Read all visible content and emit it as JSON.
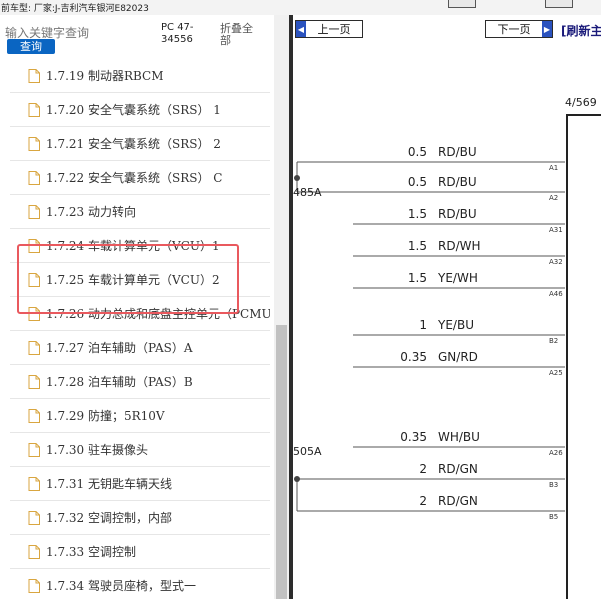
{
  "window": {
    "caption": "前车型: 厂家:J-吉利汽车银河E82023"
  },
  "sidebar": {
    "search_placeholder": "输入关键字查询",
    "search_button": "查询",
    "pc_label": "PC 47-34556",
    "collapse_all": "折叠全部",
    "items": [
      {
        "label": "1.7.19 制动器RBCM"
      },
      {
        "label": "1.7.20 安全气囊系统（SRS） 1"
      },
      {
        "label": "1.7.21 安全气囊系统（SRS） 2"
      },
      {
        "label": "1.7.22 安全气囊系统（SRS） C"
      },
      {
        "label": "1.7.23 动力转向"
      },
      {
        "label": "1.7.24 车载计算单元（VCU）1"
      },
      {
        "label": "1.7.25 车载计算单元（VCU）2"
      },
      {
        "label": "1.7.26 动力总成和底盘主控单元（PCMU"
      },
      {
        "label": "1.7.27 泊车辅助（PAS）A"
      },
      {
        "label": "1.7.28 泊车辅助（PAS）B"
      },
      {
        "label": "1.7.29 防撞；5R10V"
      },
      {
        "label": "1.7.30 驻车摄像头"
      },
      {
        "label": "1.7.31 无钥匙车辆天线"
      },
      {
        "label": "1.7.32 空调控制，内部"
      },
      {
        "label": "1.7.33 空调控制"
      },
      {
        "label": "1.7.34 驾驶员座椅，型式一"
      }
    ]
  },
  "viewer": {
    "prev_button": "上一页",
    "next_button": "下一页",
    "refresh_link": "[刷新主",
    "page_counter": "4/569",
    "splices": [
      "485A",
      "505A"
    ],
    "wires": [
      {
        "gauge": "0.5",
        "color": "RD/BU",
        "pin": "A1"
      },
      {
        "gauge": "0.5",
        "color": "RD/BU",
        "pin": "A2"
      },
      {
        "gauge": "1.5",
        "color": "RD/BU",
        "pin": "A31"
      },
      {
        "gauge": "1.5",
        "color": "RD/WH",
        "pin": "A32"
      },
      {
        "gauge": "1.5",
        "color": "YE/WH",
        "pin": "A46"
      },
      {
        "gauge": "1",
        "color": "YE/BU",
        "pin": "B2"
      },
      {
        "gauge": "0.35",
        "color": "GN/RD",
        "pin": "A25"
      },
      {
        "gauge": "0.35",
        "color": "WH/BU",
        "pin": "A26"
      },
      {
        "gauge": "2",
        "color": "RD/GN",
        "pin": "B3"
      },
      {
        "gauge": "2",
        "color": "RD/GN",
        "pin": "B5"
      }
    ]
  },
  "colors": {
    "search_button_bg": "#0a65c2",
    "highlight_border": "#e9595e",
    "nav_arrow_bg": "#2a52be",
    "file_icon": "#d9a640"
  }
}
